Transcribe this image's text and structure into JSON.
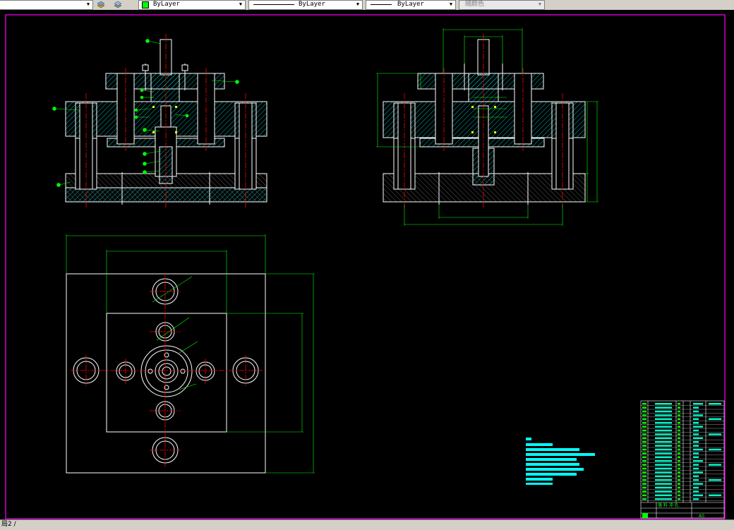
{
  "toolbar": {
    "dropdown1_arrow": "▼",
    "layer_color_label": "ByLayer",
    "linetype_label": "ByLayer",
    "lineweight_label": "ByLayer",
    "plotstyle_label": "随颜色"
  },
  "drawing": {
    "title_block": {
      "name_row": "落 料 冲 孔",
      "sheet": "A0"
    }
  },
  "command_line": {
    "text": "局2 /"
  },
  "colors": {
    "background": "#000000",
    "border": "#ff00ff",
    "outline": "#ffffff",
    "hatch": "#00ffff",
    "dimension": "#00ff00",
    "centerline": "#ff0000",
    "highlight": "#ffff00"
  }
}
